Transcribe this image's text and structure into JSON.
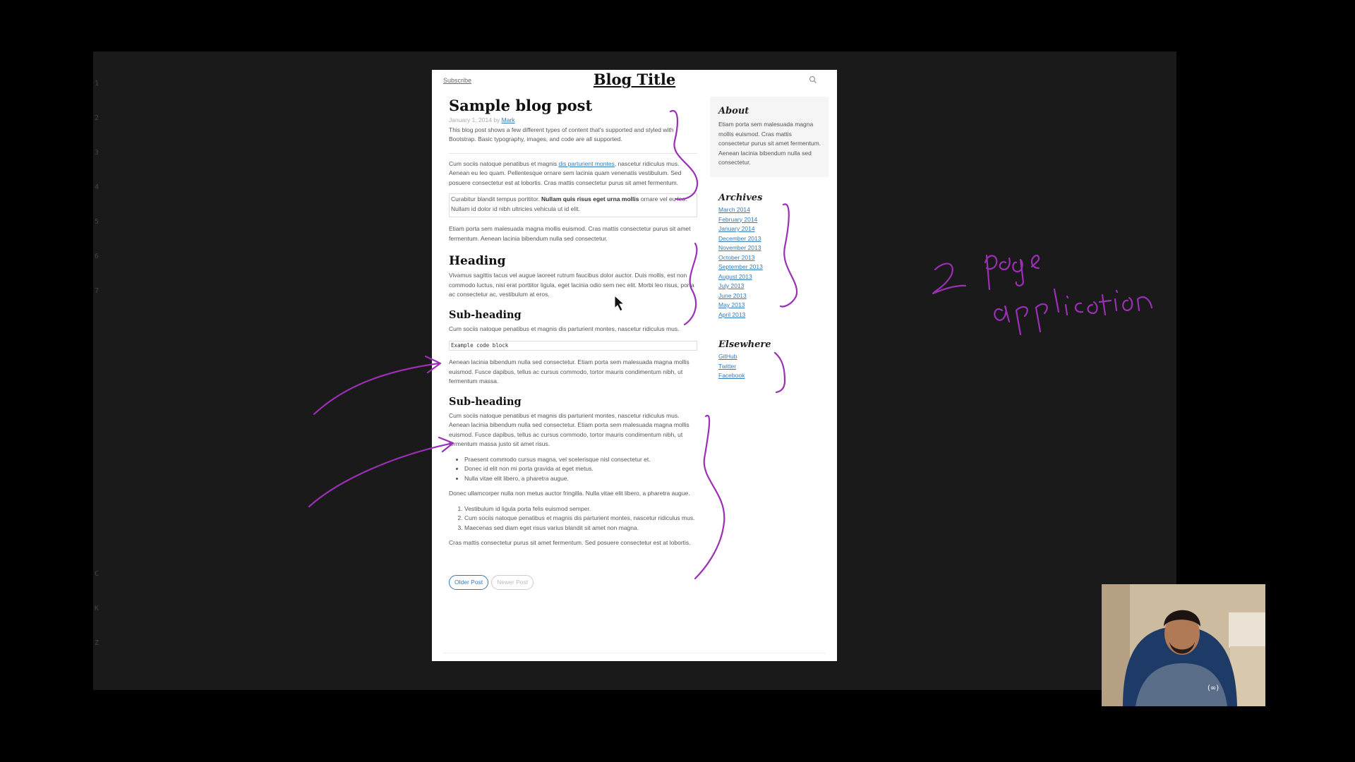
{
  "blog": {
    "subscribe": "Subscribe",
    "title": "Blog Title"
  },
  "post": {
    "title": "Sample blog post",
    "meta_date": "January 1, 2014 by ",
    "meta_author": "Mark",
    "lead": "This blog post shows a few different types of content that's supported and styled with Bootstrap. Basic typography, images, and code are all supported.",
    "p1_a": "Cum sociis natoque penatibus et magnis ",
    "p1_link": "dis parturient montes",
    "p1_b": ", nascetur ridiculus mus. Aenean eu leo quam. Pellentesque ornare sem lacinia quam venenatis vestibulum. Sed posuere consectetur est at lobortis. Cras mattis consectetur purus sit amet fermentum.",
    "quote_a": "Curabitur blandit tempus porttitor. ",
    "quote_bold": "Nullam quis risus eget urna mollis",
    "quote_b": " ornare vel eu leo. Nullam id dolor id nibh ultricies vehicula ut id elit.",
    "p2": "Etiam porta sem malesuada magna mollis euismod. Cras mattis consectetur purus sit amet fermentum. Aenean lacinia bibendum nulla sed consectetur.",
    "heading": "Heading",
    "p3": "Vivamus sagittis lacus vel augue laoreet rutrum faucibus dolor auctor. Duis mollis, est non commodo luctus, nisi erat porttitor ligula, eget lacinia odio sem nec elit. Morbi leo risus, porta ac consectetur ac, vestibulum at eros.",
    "subheading1": "Sub-heading",
    "p4": "Cum sociis natoque penatibus et magnis dis parturient montes, nascetur ridiculus mus.",
    "code": "Example code block",
    "p5": "Aenean lacinia bibendum nulla sed consectetur. Etiam porta sem malesuada magna mollis euismod. Fusce dapibus, tellus ac cursus commodo, tortor mauris condimentum nibh, ut fermentum massa.",
    "subheading2": "Sub-heading",
    "p6": "Cum sociis natoque penatibus et magnis dis parturient montes, nascetur ridiculus mus. Aenean lacinia bibendum nulla sed consectetur. Etiam porta sem malesuada magna mollis euismod. Fusce dapibus, tellus ac cursus commodo, tortor mauris condimentum nibh, ut fermentum massa justo sit amet risus.",
    "bullets": [
      "Praesent commodo cursus magna, vel scelerisque nisl consectetur et.",
      "Donec id elit non mi porta gravida at eget metus.",
      "Nulla vitae elit libero, a pharetra augue."
    ],
    "p7": "Donec ullamcorper nulla non metus auctor fringilla. Nulla vitae elit libero, a pharetra augue.",
    "ordered": [
      "Vestibulum id ligula porta felis euismod semper.",
      "Cum sociis natoque penatibus et magnis dis parturient montes, nascetur ridiculus mus.",
      "Maecenas sed diam eget risus varius blandit sit amet non magna."
    ],
    "p8": "Cras mattis consectetur purus sit amet fermentum. Sed posuere consectetur est at lobortis."
  },
  "pager": {
    "older": "Older Post",
    "newer": "Newer Post"
  },
  "sidebar": {
    "about_title": "About",
    "about_text": "Etiam porta sem malesuada magna mollis euismod. Cras mattis consectetur purus sit amet fermentum. Aenean lacinia bibendum nulla sed consectetur.",
    "archives_title": "Archives",
    "archives": [
      "March 2014",
      "February 2014",
      "January 2014",
      "December 2013",
      "November 2013",
      "October 2013",
      "September 2013",
      "August 2013",
      "July 2013",
      "June 2013",
      "May 2013",
      "April 2013"
    ],
    "elsewhere_title": "Elsewhere",
    "elsewhere": [
      "GitHub",
      "Twitter",
      "Facebook"
    ]
  },
  "annotation": {
    "line1": "2 page",
    "line2": "application",
    "color": "#9b2fb5"
  },
  "gutter": [
    "1",
    "2",
    "3",
    "4",
    "5",
    "6",
    "7",
    "C",
    "K",
    "Z"
  ],
  "colors": {
    "link": "#337ab7",
    "background": "#000000",
    "stage": "#1a1a1a"
  }
}
